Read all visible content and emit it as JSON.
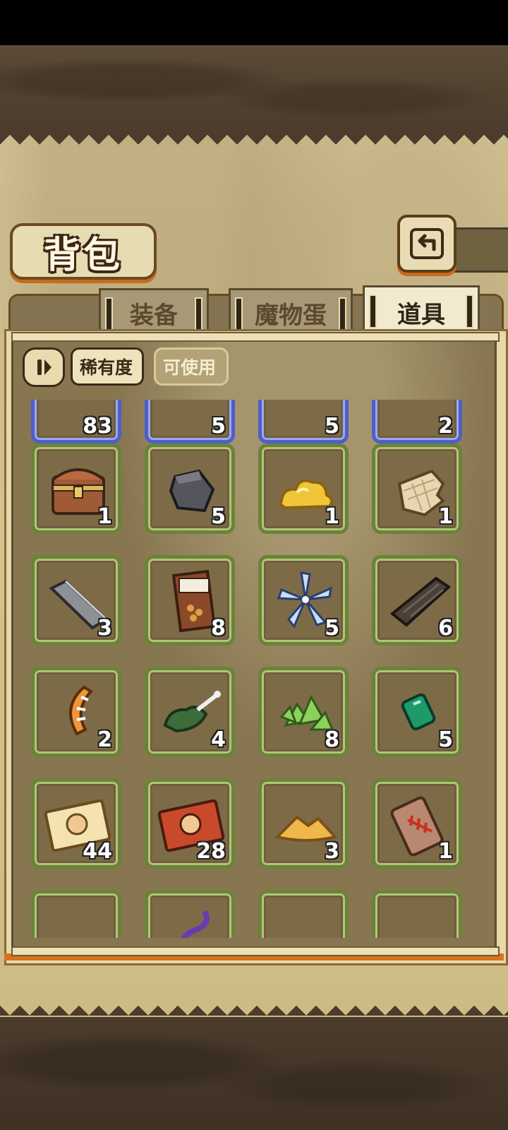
{
  "screen": {
    "title": "背包"
  },
  "tabs": [
    {
      "label": "装备",
      "active": false
    },
    {
      "label": "魔物蛋",
      "active": false
    },
    {
      "label": "道具",
      "active": true
    }
  ],
  "filters": {
    "rarity_label": "稀有度",
    "usable_label": "可使用"
  },
  "colors": {
    "slot_green": "#69843a",
    "slot_blue": "#4e5fc7",
    "accent_orange": "#d8741e"
  },
  "items": [
    {
      "icon": "scroll-icon",
      "count": "83",
      "rarity": "blue"
    },
    {
      "icon": "ore-icon",
      "count": "5",
      "rarity": "blue"
    },
    {
      "icon": "feather-icon",
      "count": "5",
      "rarity": "blue"
    },
    {
      "icon": "crystal-icon",
      "count": "2",
      "rarity": "blue"
    },
    {
      "icon": "treasure-chest-icon",
      "count": "1",
      "rarity": "green"
    },
    {
      "icon": "stone-block-icon",
      "count": "5",
      "rarity": "green"
    },
    {
      "icon": "gold-nugget-icon",
      "count": "1",
      "rarity": "green"
    },
    {
      "icon": "cloth-scrap-icon",
      "count": "1",
      "rarity": "green"
    },
    {
      "icon": "iron-bar-icon",
      "count": "3",
      "rarity": "green"
    },
    {
      "icon": "snack-bag-icon",
      "count": "8",
      "rarity": "green"
    },
    {
      "icon": "blue-flower-icon",
      "count": "5",
      "rarity": "green"
    },
    {
      "icon": "wood-plank-icon",
      "count": "6",
      "rarity": "green"
    },
    {
      "icon": "horn-icon",
      "count": "2",
      "rarity": "green"
    },
    {
      "icon": "herb-bone-icon",
      "count": "4",
      "rarity": "green"
    },
    {
      "icon": "green-crystals-icon",
      "count": "8",
      "rarity": "green"
    },
    {
      "icon": "emerald-gem-icon",
      "count": "5",
      "rarity": "green"
    },
    {
      "icon": "gold-ticket-icon",
      "count": "44",
      "rarity": "green"
    },
    {
      "icon": "red-ticket-icon",
      "count": "28",
      "rarity": "green"
    },
    {
      "icon": "sand-pile-icon",
      "count": "3",
      "rarity": "green"
    },
    {
      "icon": "fish-bone-tag-icon",
      "count": "1",
      "rarity": "green"
    },
    {
      "icon": "dark-item-icon",
      "count": "",
      "rarity": "green"
    },
    {
      "icon": "purple-tentacle-icon",
      "count": "",
      "rarity": "green"
    },
    {
      "icon": "pearl-icon",
      "count": "",
      "rarity": "green"
    },
    {
      "icon": "blue-shard-icon",
      "count": "",
      "rarity": "green"
    }
  ]
}
